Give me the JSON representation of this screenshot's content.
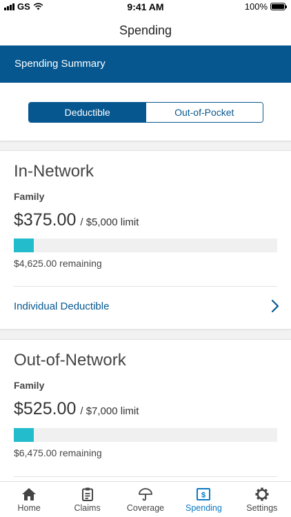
{
  "status_bar": {
    "carrier": "GS",
    "time": "9:41 AM",
    "battery": "100%"
  },
  "header": {
    "title": "Spending"
  },
  "summary": {
    "label": "Spending Summary"
  },
  "segments": {
    "items": [
      "Deductible",
      "Out-of-Pocket"
    ],
    "selected": "Deductible"
  },
  "in_network": {
    "title": "In-Network",
    "subtitle": "Family",
    "amount": "$375.00",
    "limit": "/ $5,000 limit",
    "progress_fraction": 0.075,
    "remaining": "$4,625.00 remaining",
    "link": "Individual Deductible"
  },
  "out_network": {
    "title": "Out-of-Network",
    "subtitle": "Family",
    "amount": "$525.00",
    "limit": "/ $7,000 limit",
    "progress_fraction": 0.075,
    "remaining": "$6,475.00 remaining"
  },
  "tabs": [
    {
      "label": "Home",
      "icon": "home-icon"
    },
    {
      "label": "Claims",
      "icon": "clipboard-icon"
    },
    {
      "label": "Coverage",
      "icon": "umbrella-icon"
    },
    {
      "label": "Spending",
      "icon": "dollar-icon"
    },
    {
      "label": "Settings",
      "icon": "gear-icon"
    }
  ],
  "active_tab": "Spending",
  "colors": {
    "brand": "#06578f",
    "progress": "#22bccc",
    "active_tab": "#0a78c2"
  }
}
